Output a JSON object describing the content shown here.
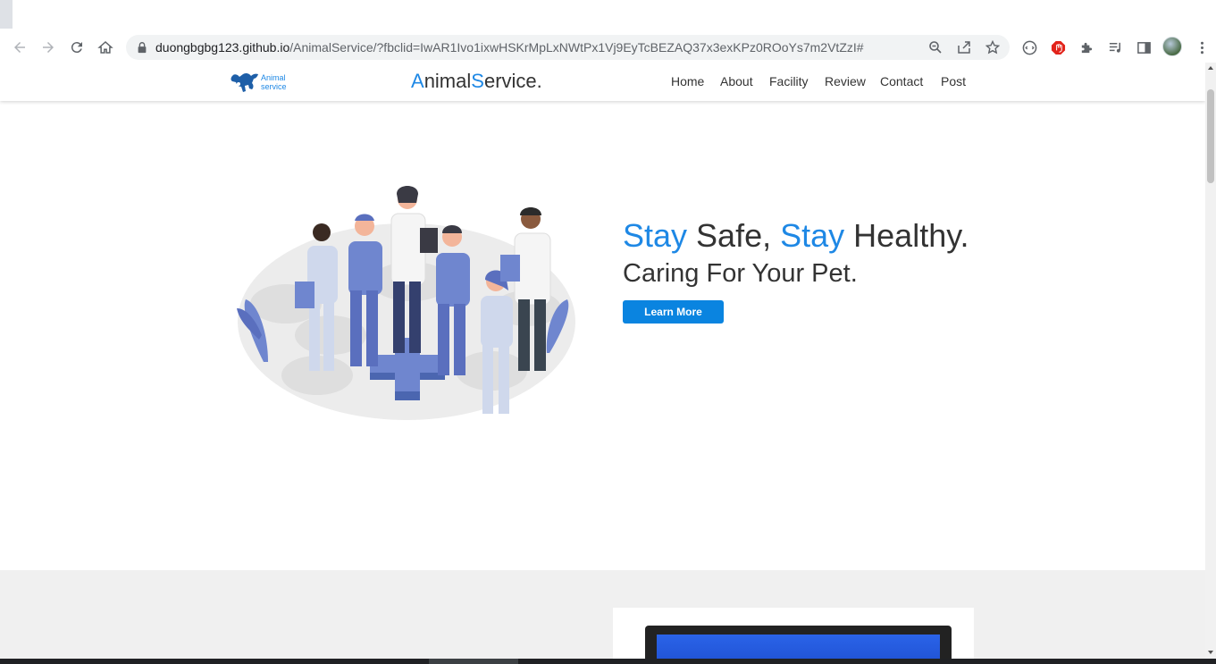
{
  "browser": {
    "url_host": "duongbgbg123.github.io",
    "url_path": "/AnimalService/?fbclid=IwAR1Ivo1ixwHSKrMpLxNWtPx1Vj9EyTcBEZAQ37x3exKPz0ROoYs7m2VtZzI#",
    "icons": [
      "back-icon",
      "forward-icon",
      "reload-icon",
      "home-icon",
      "lock-icon",
      "zoom-icon",
      "share-icon",
      "star-icon",
      "extension-icon",
      "adblock-icon",
      "puzzle-icon",
      "media-icon",
      "side-panel-icon",
      "profile-avatar",
      "menu-icon"
    ]
  },
  "header": {
    "logo_line1": "Animal",
    "logo_line2": "service",
    "brand_a": "A",
    "brand_nimal": "nimal",
    "brand_s": "S",
    "brand_ervice": "ervice.",
    "nav": [
      {
        "label": "Home"
      },
      {
        "label": "About"
      },
      {
        "label": "Facility"
      },
      {
        "label": "Review"
      },
      {
        "label": "Contact"
      },
      {
        "label": "Post"
      }
    ]
  },
  "hero": {
    "title_w1": "Stay",
    "title_w2": " Safe, ",
    "title_w3": "Stay",
    "title_w4": " Healthy.",
    "subtitle": "Caring For Your Pet.",
    "button_label": "Learn More"
  },
  "colors": {
    "accent": "#1e88e5",
    "button": "#0a84e0",
    "text": "#333333",
    "section_bg": "#f0f0f0"
  }
}
